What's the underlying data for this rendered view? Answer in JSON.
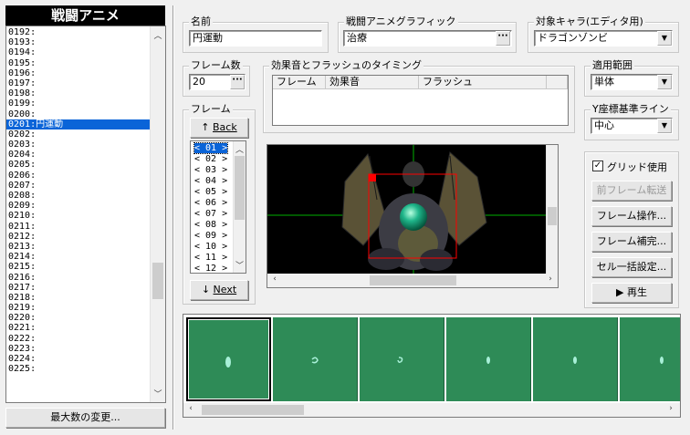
{
  "left_panel": {
    "title": "戦闘アニメ",
    "items": [
      "0192:",
      "0193:",
      "0194:",
      "0195:",
      "0196:",
      "0197:",
      "0198:",
      "0199:",
      "0200:",
      "0201:円運動",
      "0202:",
      "0203:",
      "0204:",
      "0205:",
      "0206:",
      "0207:",
      "0208:",
      "0209:",
      "0210:",
      "0211:",
      "0212:",
      "0213:",
      "0214:",
      "0215:",
      "0216:",
      "0217:",
      "0218:",
      "0219:",
      "0220:",
      "0221:",
      "0222:",
      "0223:",
      "0224:",
      "0225:"
    ],
    "max_button_label": "最大数の変更..."
  },
  "name_group": {
    "label": "名前",
    "value": "円運動"
  },
  "graphic_group": {
    "label": "戦闘アニメグラフィック",
    "value": "治療"
  },
  "target_group": {
    "label": "対象キャラ(エディタ用)",
    "value": "ドラゴンゾンビ"
  },
  "frame_count_group": {
    "label": "フレーム数",
    "value": "20"
  },
  "timing_group": {
    "label": "効果音とフラッシュのタイミング",
    "columns": [
      "フレーム",
      "効果音",
      "フラッシュ"
    ]
  },
  "scope_group": {
    "label": "適用範囲",
    "value": "単体"
  },
  "yaxis_group": {
    "label": "Y座標基準ライン",
    "value": "中心"
  },
  "frames_group": {
    "label": "フレーム",
    "back_label": "Back",
    "next_label": "Next",
    "items": [
      "< 01 >",
      "< 02 >",
      "< 03 >",
      "< 04 >",
      "< 05 >",
      "< 06 >",
      "< 07 >",
      "< 08 >",
      "< 09 >",
      "< 10 >",
      "< 11 >",
      "< 12 >"
    ]
  },
  "side_buttons": {
    "grid_label": "グリッド使用",
    "grid_checked": true,
    "prev_frame": "前フレーム転送",
    "frame_ops": "フレーム操作...",
    "frame_interp": "フレーム補完...",
    "cell_batch": "セル一括設定...",
    "play": "再生"
  },
  "colors": {
    "selection": "#0a64d8",
    "preview_bg": "#000000",
    "grid_line": "#00b000",
    "cell_frame": "#ff0000",
    "film_bg": "#2e8b57"
  }
}
